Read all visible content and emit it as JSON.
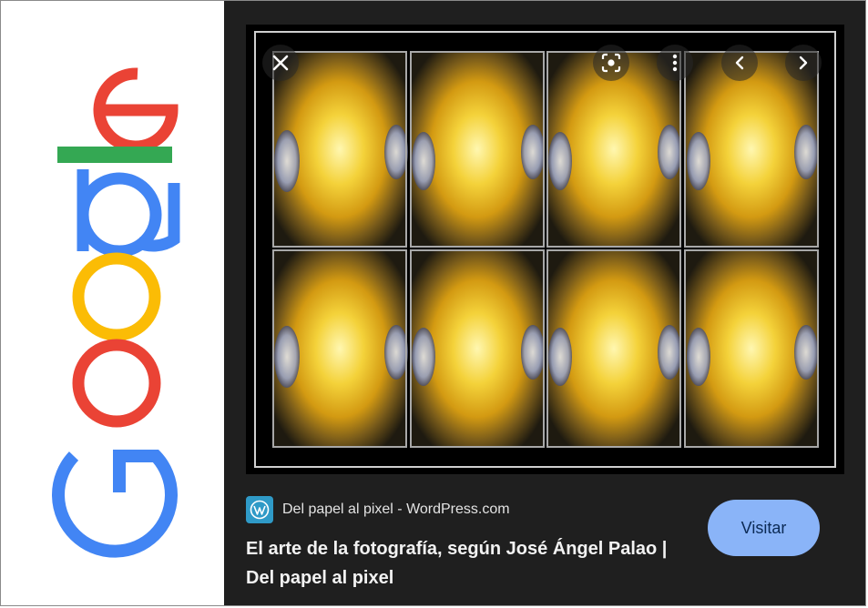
{
  "logo": {
    "text": "Google",
    "colors": [
      "#4285f4",
      "#ea4335",
      "#fbbc05",
      "#4285f4",
      "#34a853",
      "#ea4335"
    ]
  },
  "viewer": {
    "controls": {
      "close": "close-icon",
      "lens": "lens-icon",
      "more": "more-vert-icon",
      "prev": "chevron-left-icon",
      "next": "chevron-right-icon"
    },
    "source": {
      "icon": "wordpress-icon",
      "name": "Del papel al pixel - WordPress.com"
    },
    "title": "El arte de la fotografía, según José Ángel Palao | Del papel al pixel",
    "visit_label": "Visitar"
  },
  "colors": {
    "panel_bg": "#1f1f1f",
    "accent": "#8ab4f8",
    "google_blue": "#4285f4",
    "google_red": "#ea4335",
    "google_yellow": "#fbbc05",
    "google_green": "#34a853"
  }
}
